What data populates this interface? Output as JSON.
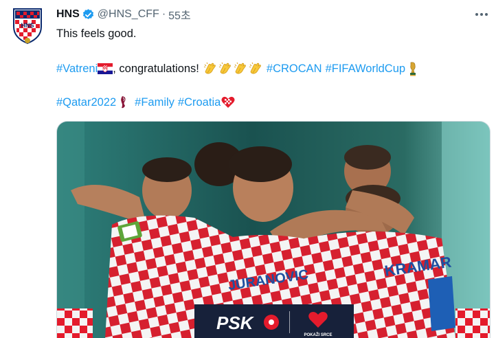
{
  "author": {
    "display_name": "HNS",
    "handle": "@HNS_CFF",
    "separator": "·",
    "time": "55초",
    "verified": true
  },
  "avatar_icon": "hns-crest-icon",
  "more_icon": "more-horizontal-icon",
  "tweet": {
    "line1": "This feels good.",
    "line2": {
      "tag1": "#Vatreni",
      "flag_icon": "croatia-flag-icon",
      "text": ", congratulations!",
      "clap_icon": "clapping-hands-icon",
      "clap_count": 4,
      "tag2": "#CROCAN",
      "tag3": "#FIFAWorldCup",
      "trophy_icon": "world-cup-trophy-icon"
    },
    "line3": {
      "tag1": "#Qatar2022",
      "tag1_icon": "qatar-2022-icon",
      "tag2": "#Family",
      "tag3": "#Croatia",
      "tag3_icon": "croatia-heart-icon"
    }
  },
  "media": {
    "sponsor_name": "PSK",
    "sponsor_tagline": "POKAŽI SRCE",
    "jersey_name_1": "KRAMAR",
    "jersey_name_2": "JURANOVIC"
  },
  "colors": {
    "link": "#1d9bf0",
    "text": "#0f1419",
    "secondary": "#536471",
    "croatia_red": "#e41b2c"
  }
}
